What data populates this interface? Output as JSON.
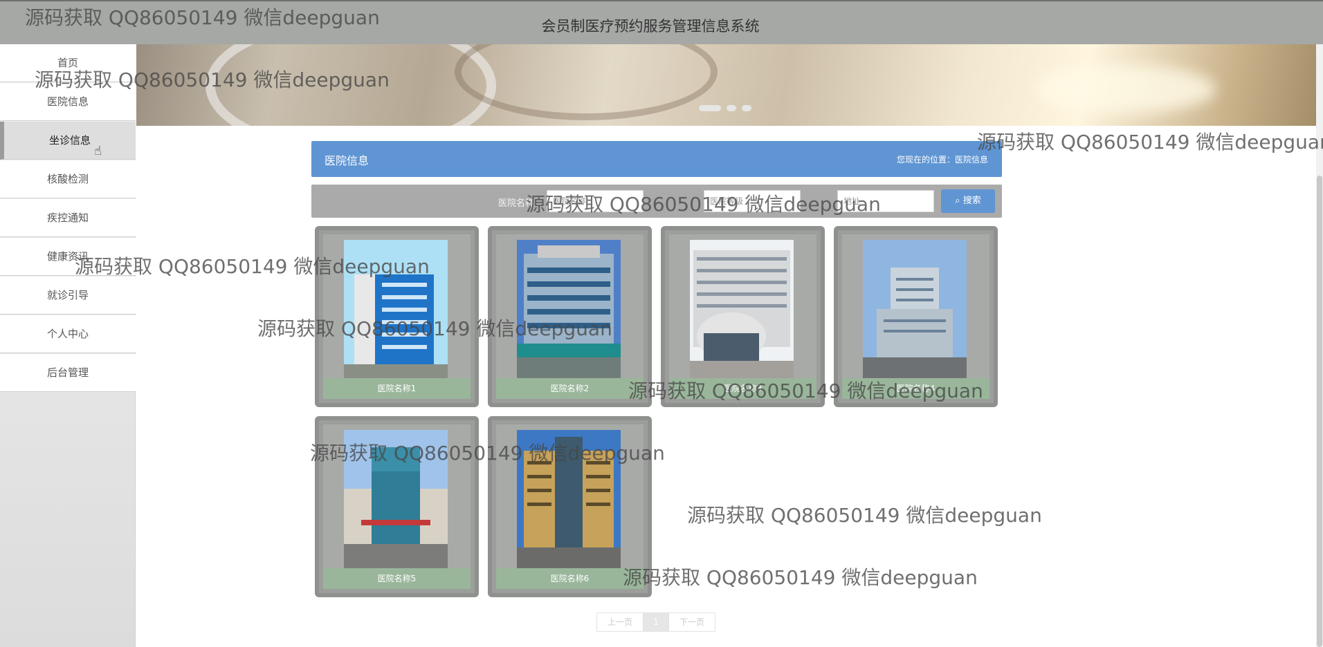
{
  "app": {
    "title": "会员制医疗预约服务管理信息系统"
  },
  "sidebar": {
    "items": [
      {
        "label": "首页"
      },
      {
        "label": "医院信息"
      },
      {
        "label": "坐诊信息"
      },
      {
        "label": "核酸检测"
      },
      {
        "label": "疾控通知"
      },
      {
        "label": "健康资讯"
      },
      {
        "label": "就诊引导"
      },
      {
        "label": "个人中心"
      },
      {
        "label": "后台管理"
      }
    ]
  },
  "section": {
    "title": "医院信息",
    "location_prefix": "您现在的位置：",
    "location": "医院信息"
  },
  "search": {
    "field1_label": "医院名称",
    "field1_placeholder": "医院名称",
    "field2_placeholder": "医院等级",
    "field3_placeholder": "地址",
    "button_label": "搜索"
  },
  "cards": [
    {
      "name": "医院名称1"
    },
    {
      "name": "医院名称2"
    },
    {
      "name": "医院名称3"
    },
    {
      "name": "医院名称4"
    },
    {
      "name": "医院名称5"
    },
    {
      "name": "医院名称6"
    }
  ],
  "pager": {
    "prev": "上一页",
    "current": "1",
    "next": "下一页"
  },
  "watermark": {
    "text": "源码获取 QQ86050149 微信deepguan"
  },
  "colors": {
    "accent": "#5f95d3",
    "topbar": "#a5a8a5",
    "caption": "#99b69a"
  }
}
